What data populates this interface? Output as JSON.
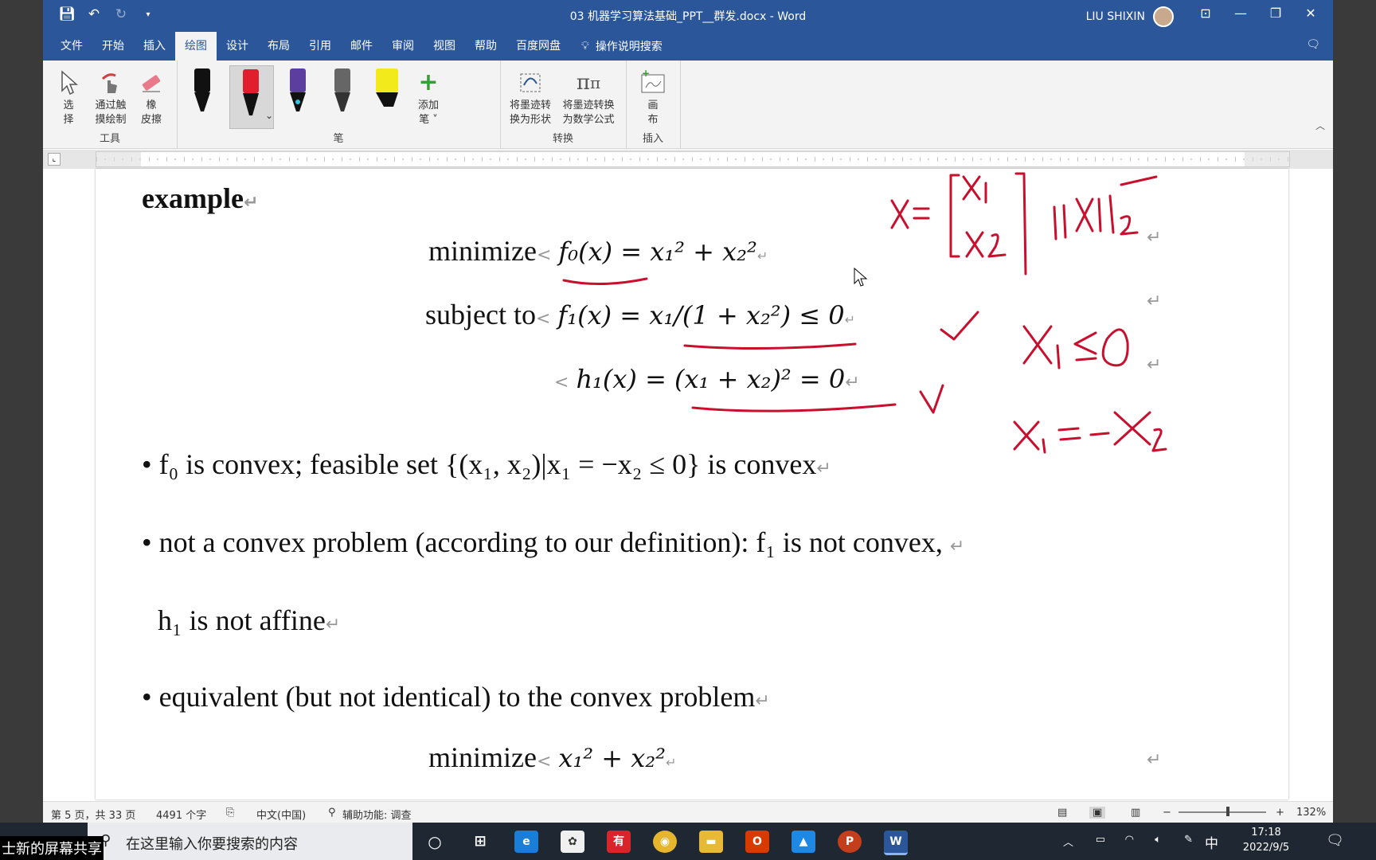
{
  "titlebar": {
    "title": "03 机器学习算法基础_PPT__群发.docx  -  Word",
    "user": "LIU SHIXIN"
  },
  "menu": {
    "tabs": [
      "文件",
      "开始",
      "插入",
      "绘图",
      "设计",
      "布局",
      "引用",
      "邮件",
      "审阅",
      "视图",
      "帮助",
      "百度网盘"
    ],
    "active": "绘图",
    "search": "操作说明搜索"
  },
  "ribbon": {
    "tools_group": "工具",
    "pen_group": "笔",
    "convert_group": "转换",
    "insert_group": "插入",
    "select_label": [
      "选",
      "择"
    ],
    "touch_label": [
      "通过触",
      "摸绘制"
    ],
    "eraser_label": [
      "橡",
      "皮擦"
    ],
    "add_pen_label": [
      "添加",
      "笔 ˅"
    ],
    "ink_shape_label": [
      "将墨迹转",
      "换为形状"
    ],
    "ink_math_label": [
      "将墨迹转换",
      "为数学公式"
    ],
    "canvas_label": [
      "画",
      "布"
    ]
  },
  "colors": {
    "brand": "#2b579a",
    "ink": "#c8102e"
  },
  "document": {
    "heading": "example",
    "minimize": "minimize",
    "subject_to": "subject to",
    "f0_eq": "f₀(x) = x₁² + x₂²",
    "f1_eq": "f₁(x) = x₁/(1 + x₂²) ≤ 0",
    "h1_eq": "h₁(x) = (x₁ + x₂)² = 0",
    "bullet1": "• f₀  is convex; feasible set  {(x₁, x₂)|x₁ = −x₂ ≤ 0}  is convex",
    "bullet2": "• not a convex problem (according to our definition):  f₁  is not convex,",
    "bullet2_cont": "h₁  is not affine",
    "bullet3": "• equivalent (but not identical) to the convex problem",
    "min2_eq": "x₁² + x₂²"
  },
  "status": {
    "page": "第 5 页，共 33 页",
    "words": "4491 个字",
    "lang": "中文(中国)",
    "access": "辅助功能: 调查",
    "zoom": "132%"
  },
  "taskbar": {
    "search": "在这里输入你要搜索的内容",
    "share_label": "士新的屏幕共享",
    "time": "17:18",
    "date": "2022/9/5",
    "ime": "中"
  }
}
